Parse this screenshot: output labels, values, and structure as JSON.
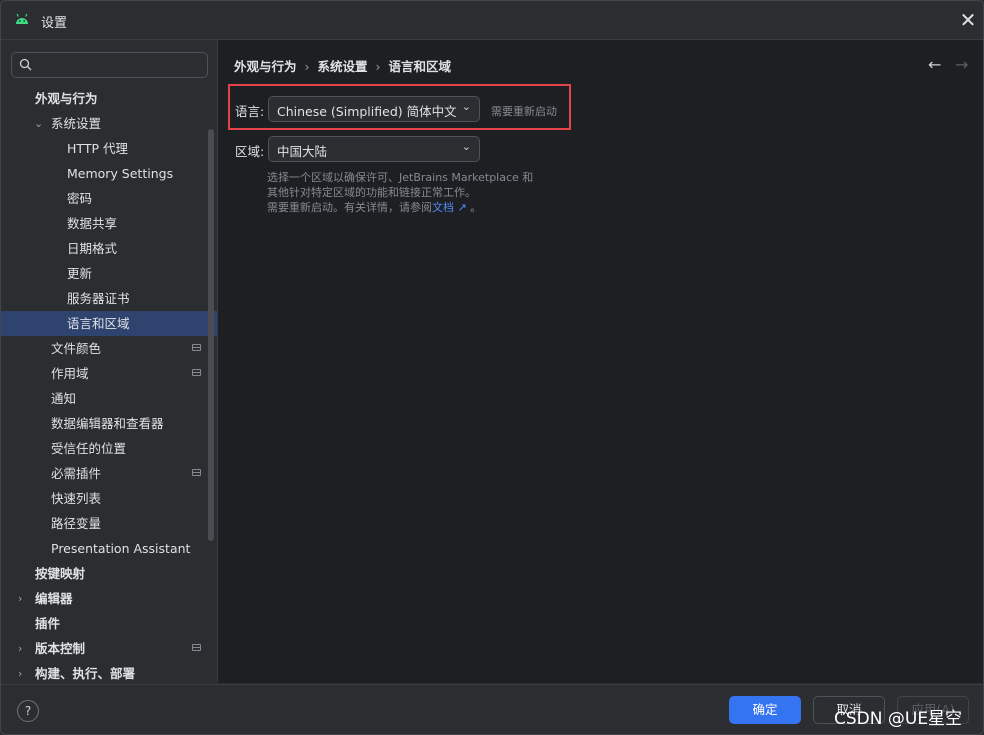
{
  "window": {
    "title": "设置"
  },
  "search": {
    "placeholder": "",
    "value": ""
  },
  "tree": [
    {
      "label": "外观与行为",
      "bold": true
    },
    {
      "label": "系统设置",
      "expanded": true
    },
    {
      "label": "HTTP 代理"
    },
    {
      "label": "Memory Settings"
    },
    {
      "label": "密码"
    },
    {
      "label": "数据共享"
    },
    {
      "label": "日期格式"
    },
    {
      "label": "更新"
    },
    {
      "label": "服务器证书"
    },
    {
      "label": "语言和区域",
      "selected": true
    },
    {
      "label": "文件颜色",
      "modified": true
    },
    {
      "label": "作用域",
      "modified": true
    },
    {
      "label": "通知"
    },
    {
      "label": "数据编辑器和查看器"
    },
    {
      "label": "受信任的位置"
    },
    {
      "label": "必需插件",
      "modified": true
    },
    {
      "label": "快速列表"
    },
    {
      "label": "路径变量"
    },
    {
      "label": "Presentation Assistant"
    },
    {
      "label": "按键映射",
      "bold": true
    },
    {
      "label": "编辑器",
      "bold": true,
      "collapsed": true
    },
    {
      "label": "插件",
      "bold": true
    },
    {
      "label": "版本控制",
      "bold": true,
      "collapsed": true,
      "modified": true
    },
    {
      "label": "构建、执行、部署",
      "bold": true,
      "collapsed": true
    }
  ],
  "breadcrumb": [
    "外观与行为",
    "系统设置",
    "语言和区域"
  ],
  "language": {
    "label": "语言:",
    "value": "Chinese (Simplified) 简体中文",
    "note": "需要重新启动"
  },
  "region": {
    "label": "区域:",
    "value": "中国大陆",
    "help_line1": "选择一个区域以确保许可、JetBrains Marketplace 和",
    "help_line2": "其他针对特定区域的功能和链接正常工作。",
    "help_line3_prefix": "需要重新启动。有关详情，请参阅",
    "help_link": "文档 ↗",
    "help_line3_suffix": " 。"
  },
  "footer": {
    "help": "?",
    "ok": "确定",
    "cancel": "取消",
    "apply": "应用(A)"
  },
  "watermark": "CSDN @UE星空",
  "colors": {
    "accent": "#3574f0",
    "selection": "#2e436e",
    "highlight_box": "#e5434a",
    "link": "#548af7"
  },
  "icons": {
    "app": "android-icon",
    "search": "search-icon",
    "close": "close-icon"
  }
}
